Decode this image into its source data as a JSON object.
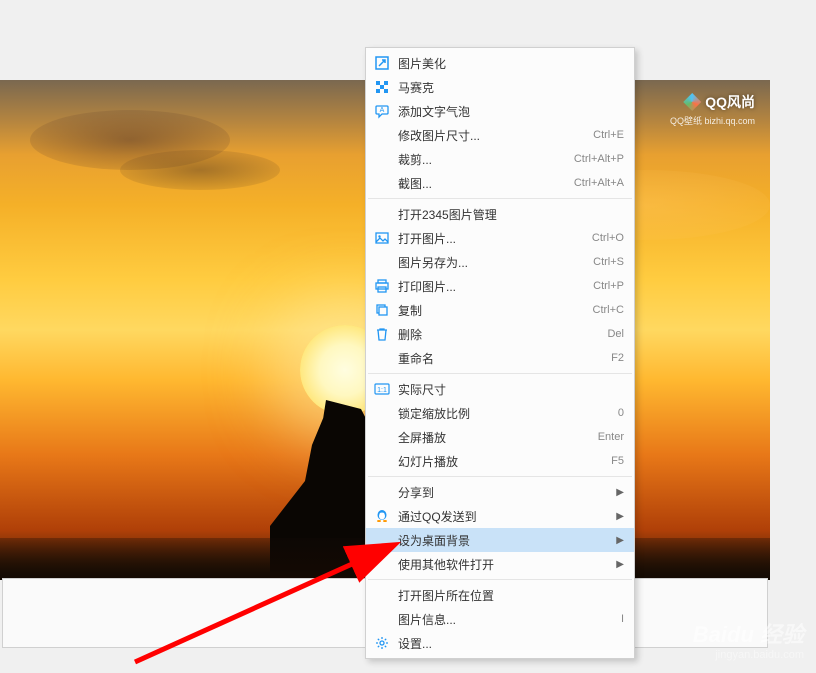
{
  "logo": {
    "text": "QQ风尚",
    "sub": "QQ壁纸  bizhi.qq.com"
  },
  "menu": {
    "items": [
      {
        "id": "beautify",
        "label": "图片美化",
        "icon": "expand-icon",
        "shortcut": "",
        "hasSub": false
      },
      {
        "id": "mosaic",
        "label": "马赛克",
        "icon": "mosaic-icon",
        "shortcut": "",
        "hasSub": false
      },
      {
        "id": "textbubble",
        "label": "添加文字气泡",
        "icon": "bubble-icon",
        "shortcut": "",
        "hasSub": false
      },
      {
        "id": "resize",
        "label": "修改图片尺寸...",
        "icon": "",
        "shortcut": "Ctrl+E",
        "hasSub": false
      },
      {
        "id": "crop",
        "label": "裁剪...",
        "icon": "",
        "shortcut": "Ctrl+Alt+P",
        "hasSub": false
      },
      {
        "id": "capture",
        "label": "截图...",
        "icon": "",
        "shortcut": "Ctrl+Alt+A",
        "hasSub": false
      },
      {
        "id": "open2345",
        "label": "打开2345图片管理",
        "icon": "",
        "shortcut": "",
        "hasSub": false
      },
      {
        "id": "openimg",
        "label": "打开图片...",
        "icon": "image-icon",
        "shortcut": "Ctrl+O",
        "hasSub": false
      },
      {
        "id": "saveas",
        "label": "图片另存为...",
        "icon": "",
        "shortcut": "Ctrl+S",
        "hasSub": false
      },
      {
        "id": "print",
        "label": "打印图片...",
        "icon": "print-icon",
        "shortcut": "Ctrl+P",
        "hasSub": false
      },
      {
        "id": "copy",
        "label": "复制",
        "icon": "copy-icon",
        "shortcut": "Ctrl+C",
        "hasSub": false
      },
      {
        "id": "delete",
        "label": "删除",
        "icon": "trash-icon",
        "shortcut": "Del",
        "hasSub": false
      },
      {
        "id": "rename",
        "label": "重命名",
        "icon": "",
        "shortcut": "F2",
        "hasSub": false
      },
      {
        "id": "actual",
        "label": "实际尺寸",
        "icon": "onetoone-icon",
        "shortcut": "",
        "hasSub": false
      },
      {
        "id": "lockzoom",
        "label": "锁定缩放比例",
        "icon": "",
        "shortcut": "0",
        "hasSub": false
      },
      {
        "id": "fullscreen",
        "label": "全屏播放",
        "icon": "",
        "shortcut": "Enter",
        "hasSub": false
      },
      {
        "id": "slideshow",
        "label": "幻灯片播放",
        "icon": "",
        "shortcut": "F5",
        "hasSub": false
      },
      {
        "id": "share",
        "label": "分享到",
        "icon": "",
        "shortcut": "",
        "hasSub": true
      },
      {
        "id": "qqsend",
        "label": "通过QQ发送到",
        "icon": "qq-icon",
        "shortcut": "",
        "hasSub": true
      },
      {
        "id": "setbg",
        "label": "设为桌面背景",
        "icon": "",
        "shortcut": "",
        "hasSub": true,
        "highlighted": true
      },
      {
        "id": "openwith",
        "label": "使用其他软件打开",
        "icon": "",
        "shortcut": "",
        "hasSub": true
      },
      {
        "id": "location",
        "label": "打开图片所在位置",
        "icon": "",
        "shortcut": "",
        "hasSub": false
      },
      {
        "id": "info",
        "label": "图片信息...",
        "icon": "",
        "shortcut": "I",
        "hasSub": false
      },
      {
        "id": "settings",
        "label": "设置...",
        "icon": "gear-icon",
        "shortcut": "",
        "hasSub": false
      }
    ],
    "separatorsAfter": [
      "capture",
      "rename",
      "slideshow",
      "openwith"
    ]
  },
  "watermark": {
    "main": "Baidu 经验",
    "sub": "jingyan.baidu.com"
  }
}
